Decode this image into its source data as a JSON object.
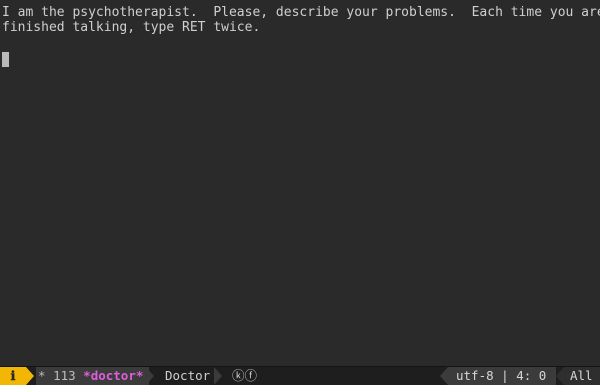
{
  "buffer": {
    "lines": [
      "I am the psychotherapist.  Please, describe your problems.  Each time you are",
      "finished talking, type RET twice."
    ]
  },
  "modeline": {
    "info_icon": "info-icon",
    "info_glyph": "ℹ",
    "modified_flag": "*",
    "line_count": "113",
    "buffer_name": "*doctor*",
    "major_mode": "Doctor",
    "minor_modes": "ⓚⓕ",
    "encoding": "utf-8",
    "separator": "|",
    "cursor_position": "4: 0",
    "scroll_position": "All"
  },
  "colors": {
    "background": "#2a2a2b",
    "text": "#cfcfcf",
    "buffer_name": "#e05edb",
    "info_accent": "#f2b705",
    "modeline_bg": "#1e1e1f"
  }
}
